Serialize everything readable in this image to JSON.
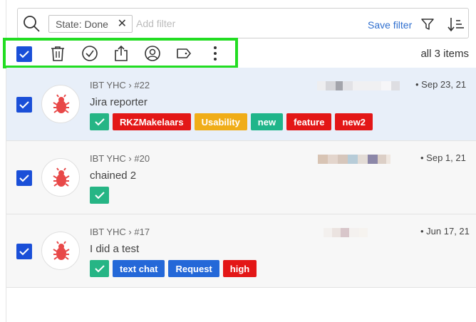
{
  "filter": {
    "chip_label": "State: Done",
    "chip_close": "✕",
    "placeholder": "Add filter",
    "save_label": "Save filter"
  },
  "toolbar": {
    "items": [
      "select-all-checkbox",
      "delete-icon",
      "resolve-icon",
      "share-icon",
      "assign-icon",
      "tag-icon",
      "more-icon"
    ],
    "count_label": "all 3 items"
  },
  "issues": [
    {
      "project": "IBT YHC › #22",
      "title": "Jira reporter",
      "date": "Sep 23, 21",
      "tags": [
        {
          "label": "RKZMakelaars",
          "color": "#e31717"
        },
        {
          "label": "Usability",
          "color": "#f0ad18"
        },
        {
          "label": "new",
          "color": "#1fb58a"
        },
        {
          "label": "feature",
          "color": "#e31717"
        },
        {
          "label": "new2",
          "color": "#e31717"
        }
      ]
    },
    {
      "project": "IBT YHC › #20",
      "title": "chained 2",
      "date": "Sep 1, 21",
      "tags": []
    },
    {
      "project": "IBT YHC › #17",
      "title": "I did a test",
      "date": "Jun 17, 21",
      "tags": [
        {
          "label": "text chat",
          "color": "#2468d8"
        },
        {
          "label": "Request",
          "color": "#2468d8"
        },
        {
          "label": "high",
          "color": "#e31717"
        }
      ]
    }
  ],
  "colors": {
    "accent": "#2f6fcf",
    "checkbox": "#1a4fd8",
    "highlight_border": "#22dd22",
    "check_tag": "#26b585",
    "bug": "#e84848"
  }
}
